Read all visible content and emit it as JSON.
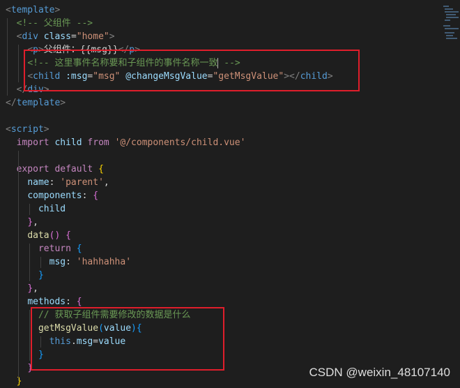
{
  "editor": {
    "language": "vue",
    "lines": [
      {
        "tokens": [
          {
            "t": "<",
            "c": "t-punct"
          },
          {
            "t": "template",
            "c": "t-tag"
          },
          {
            "t": ">",
            "c": "t-punct"
          }
        ]
      },
      {
        "tokens": [
          {
            "t": "  "
          },
          {
            "t": "<!-- 父组件 -->",
            "c": "t-comment"
          }
        ]
      },
      {
        "tokens": [
          {
            "t": "  "
          },
          {
            "t": "<",
            "c": "t-punct"
          },
          {
            "t": "div",
            "c": "t-tag"
          },
          {
            "t": " "
          },
          {
            "t": "class",
            "c": "t-attr"
          },
          {
            "t": "=",
            "c": "t-plain"
          },
          {
            "t": "\"home\"",
            "c": "t-str"
          },
          {
            "t": ">",
            "c": "t-punct"
          }
        ]
      },
      {
        "tokens": [
          {
            "t": "    "
          },
          {
            "t": "<",
            "c": "t-punct"
          },
          {
            "t": "p",
            "c": "t-tag"
          },
          {
            "t": ">",
            "c": "t-punct"
          },
          {
            "t": "父组件：{{msg}}",
            "c": "t-plain"
          },
          {
            "t": "</",
            "c": "t-punct"
          },
          {
            "t": "p",
            "c": "t-tag"
          },
          {
            "t": ">",
            "c": "t-punct"
          }
        ]
      },
      {
        "tokens": [
          {
            "t": "    "
          },
          {
            "t": "<!-- 这里事件名称要和子组件的事件名称一致",
            "c": "t-comment"
          },
          {
            "t": "|",
            "c": "cursor"
          },
          {
            "t": " -->",
            "c": "t-comment"
          }
        ]
      },
      {
        "tokens": [
          {
            "t": "    "
          },
          {
            "t": "<",
            "c": "t-punct"
          },
          {
            "t": "child",
            "c": "t-tag"
          },
          {
            "t": " "
          },
          {
            "t": ":msg",
            "c": "t-attr"
          },
          {
            "t": "=",
            "c": "t-plain"
          },
          {
            "t": "\"msg\"",
            "c": "t-str"
          },
          {
            "t": " "
          },
          {
            "t": "@changeMsgValue",
            "c": "t-attr"
          },
          {
            "t": "=",
            "c": "t-plain"
          },
          {
            "t": "\"getMsgValue\"",
            "c": "t-str"
          },
          {
            "t": ">",
            "c": "t-punct"
          },
          {
            "t": "</",
            "c": "t-punct"
          },
          {
            "t": "child",
            "c": "t-tag"
          },
          {
            "t": ">",
            "c": "t-punct"
          }
        ]
      },
      {
        "tokens": [
          {
            "t": "  "
          },
          {
            "t": "</",
            "c": "t-punct"
          },
          {
            "t": "div",
            "c": "t-tag"
          },
          {
            "t": ">",
            "c": "t-punct"
          }
        ]
      },
      {
        "tokens": [
          {
            "t": "</",
            "c": "t-punct"
          },
          {
            "t": "template",
            "c": "t-tag"
          },
          {
            "t": ">",
            "c": "t-punct"
          }
        ]
      },
      {
        "tokens": []
      },
      {
        "tokens": [
          {
            "t": "<",
            "c": "t-punct"
          },
          {
            "t": "script",
            "c": "t-tag"
          },
          {
            "t": ">",
            "c": "t-punct"
          }
        ]
      },
      {
        "tokens": [
          {
            "t": "  "
          },
          {
            "t": "import",
            "c": "t-keyword"
          },
          {
            "t": " "
          },
          {
            "t": "child",
            "c": "t-attr"
          },
          {
            "t": " "
          },
          {
            "t": "from",
            "c": "t-keyword"
          },
          {
            "t": " "
          },
          {
            "t": "'@/components/child.vue'",
            "c": "t-str"
          }
        ]
      },
      {
        "tokens": []
      },
      {
        "tokens": [
          {
            "t": "  "
          },
          {
            "t": "export",
            "c": "t-keyword"
          },
          {
            "t": " "
          },
          {
            "t": "default",
            "c": "t-keyword"
          },
          {
            "t": " "
          },
          {
            "t": "{",
            "c": "t-bracket"
          }
        ]
      },
      {
        "tokens": [
          {
            "t": "    "
          },
          {
            "t": "name",
            "c": "t-attr"
          },
          {
            "t": ": ",
            "c": "t-plain"
          },
          {
            "t": "'parent'",
            "c": "t-str"
          },
          {
            "t": ",",
            "c": "t-plain"
          }
        ]
      },
      {
        "tokens": [
          {
            "t": "    "
          },
          {
            "t": "components",
            "c": "t-attr"
          },
          {
            "t": ": ",
            "c": "t-plain"
          },
          {
            "t": "{",
            "c": "t-bracket2"
          }
        ]
      },
      {
        "tokens": [
          {
            "t": "      "
          },
          {
            "t": "child",
            "c": "t-attr"
          }
        ]
      },
      {
        "tokens": [
          {
            "t": "    "
          },
          {
            "t": "}",
            "c": "t-bracket2"
          },
          {
            "t": ",",
            "c": "t-plain"
          }
        ]
      },
      {
        "tokens": [
          {
            "t": "    "
          },
          {
            "t": "data",
            "c": "t-fn"
          },
          {
            "t": "()",
            "c": "t-bracket2"
          },
          {
            "t": " "
          },
          {
            "t": "{",
            "c": "t-bracket2"
          }
        ]
      },
      {
        "tokens": [
          {
            "t": "      "
          },
          {
            "t": "return",
            "c": "t-keyword"
          },
          {
            "t": " "
          },
          {
            "t": "{",
            "c": "t-bracket3"
          }
        ]
      },
      {
        "tokens": [
          {
            "t": "        "
          },
          {
            "t": "msg",
            "c": "t-attr"
          },
          {
            "t": ": ",
            "c": "t-plain"
          },
          {
            "t": "'hahhahha'",
            "c": "t-str"
          }
        ]
      },
      {
        "tokens": [
          {
            "t": "      "
          },
          {
            "t": "}",
            "c": "t-bracket3"
          }
        ]
      },
      {
        "tokens": [
          {
            "t": "    "
          },
          {
            "t": "}",
            "c": "t-bracket2"
          },
          {
            "t": ",",
            "c": "t-plain"
          }
        ]
      },
      {
        "tokens": [
          {
            "t": "    "
          },
          {
            "t": "methods",
            "c": "t-attr"
          },
          {
            "t": ": ",
            "c": "t-plain"
          },
          {
            "t": "{",
            "c": "t-bracket2"
          }
        ]
      },
      {
        "tokens": [
          {
            "t": "      "
          },
          {
            "t": "// 获取子组件需要修改的数据是什么",
            "c": "t-comment"
          }
        ]
      },
      {
        "tokens": [
          {
            "t": "      "
          },
          {
            "t": "getMsgValue",
            "c": "t-fn"
          },
          {
            "t": "(",
            "c": "t-bracket3"
          },
          {
            "t": "value",
            "c": "t-attr"
          },
          {
            "t": ")",
            "c": "t-bracket3"
          },
          {
            "t": "{",
            "c": "t-bracket3"
          }
        ]
      },
      {
        "tokens": [
          {
            "t": "        "
          },
          {
            "t": "this",
            "c": "t-blue"
          },
          {
            "t": ".",
            "c": "t-plain"
          },
          {
            "t": "msg",
            "c": "t-attr"
          },
          {
            "t": "=",
            "c": "t-plain"
          },
          {
            "t": "value",
            "c": "t-attr"
          }
        ]
      },
      {
        "tokens": [
          {
            "t": "      "
          },
          {
            "t": "}",
            "c": "t-bracket3"
          }
        ]
      },
      {
        "tokens": [
          {
            "t": "    "
          },
          {
            "t": "}",
            "c": "t-bracket2"
          }
        ]
      },
      {
        "tokens": [
          {
            "t": "  "
          },
          {
            "t": "}",
            "c": "t-bracket"
          }
        ]
      }
    ]
  },
  "annotations": {
    "highlight_color": "#e01e2b",
    "boxes": [
      "event-binding-highlight",
      "method-highlight"
    ]
  },
  "watermark": {
    "text": "CSDN @weixin_48107140"
  },
  "colors": {
    "background": "#1e1e1e",
    "tag": "#569cd6",
    "attribute": "#9cdcfe",
    "string": "#ce9178",
    "comment": "#6a9955",
    "keyword": "#c586c0",
    "function": "#dcdcaa"
  }
}
